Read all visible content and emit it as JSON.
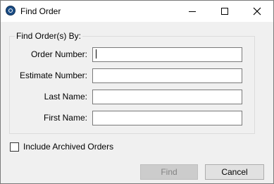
{
  "window": {
    "title": "Find Order"
  },
  "group": {
    "legend": "Find Order(s) By:"
  },
  "fields": {
    "order_number": {
      "label": "Order Number:",
      "value": ""
    },
    "estimate_number": {
      "label": "Estimate Number:",
      "value": ""
    },
    "last_name": {
      "label": "Last Name:",
      "value": ""
    },
    "first_name": {
      "label": "First Name:",
      "value": ""
    }
  },
  "options": {
    "include_archived_label": "Include Archived Orders",
    "include_archived_checked": false
  },
  "buttons": {
    "find_label": "Find",
    "find_enabled": false,
    "cancel_label": "Cancel"
  },
  "icons": {
    "app": "app-icon",
    "minimize": "minimize-icon",
    "maximize": "maximize-icon",
    "close": "close-icon"
  },
  "colors": {
    "window_bg": "#f0f0f0",
    "titlebar_bg": "#ffffff",
    "disabled_text": "#838383"
  }
}
